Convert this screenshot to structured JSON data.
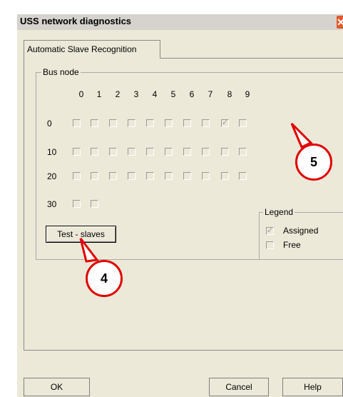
{
  "window": {
    "title": "USS network diagnostics",
    "close_label": "✕"
  },
  "tab": {
    "label": "Automatic Slave Recognition"
  },
  "bus_node": {
    "label": "Bus node",
    "columns": [
      "0",
      "1",
      "2",
      "3",
      "4",
      "5",
      "6",
      "7",
      "8",
      "9"
    ],
    "rows": [
      {
        "label": "0",
        "count": 10,
        "checked": [
          8
        ]
      },
      {
        "label": "10",
        "count": 10,
        "checked": []
      },
      {
        "label": "20",
        "count": 10,
        "checked": []
      },
      {
        "label": "30",
        "count": 2,
        "checked": []
      }
    ]
  },
  "test_button": {
    "label": "Test - slaves"
  },
  "legend": {
    "label": "Legend",
    "assigned": "Assigned",
    "free": "Free"
  },
  "footer": {
    "ok": "OK",
    "cancel": "Cancel",
    "help": "Help"
  },
  "markers": {
    "four": "4",
    "five": "5"
  },
  "colors": {
    "marker": "#e00000",
    "dialog": "#ece9d8",
    "titlebar": "#d6d3ce"
  }
}
